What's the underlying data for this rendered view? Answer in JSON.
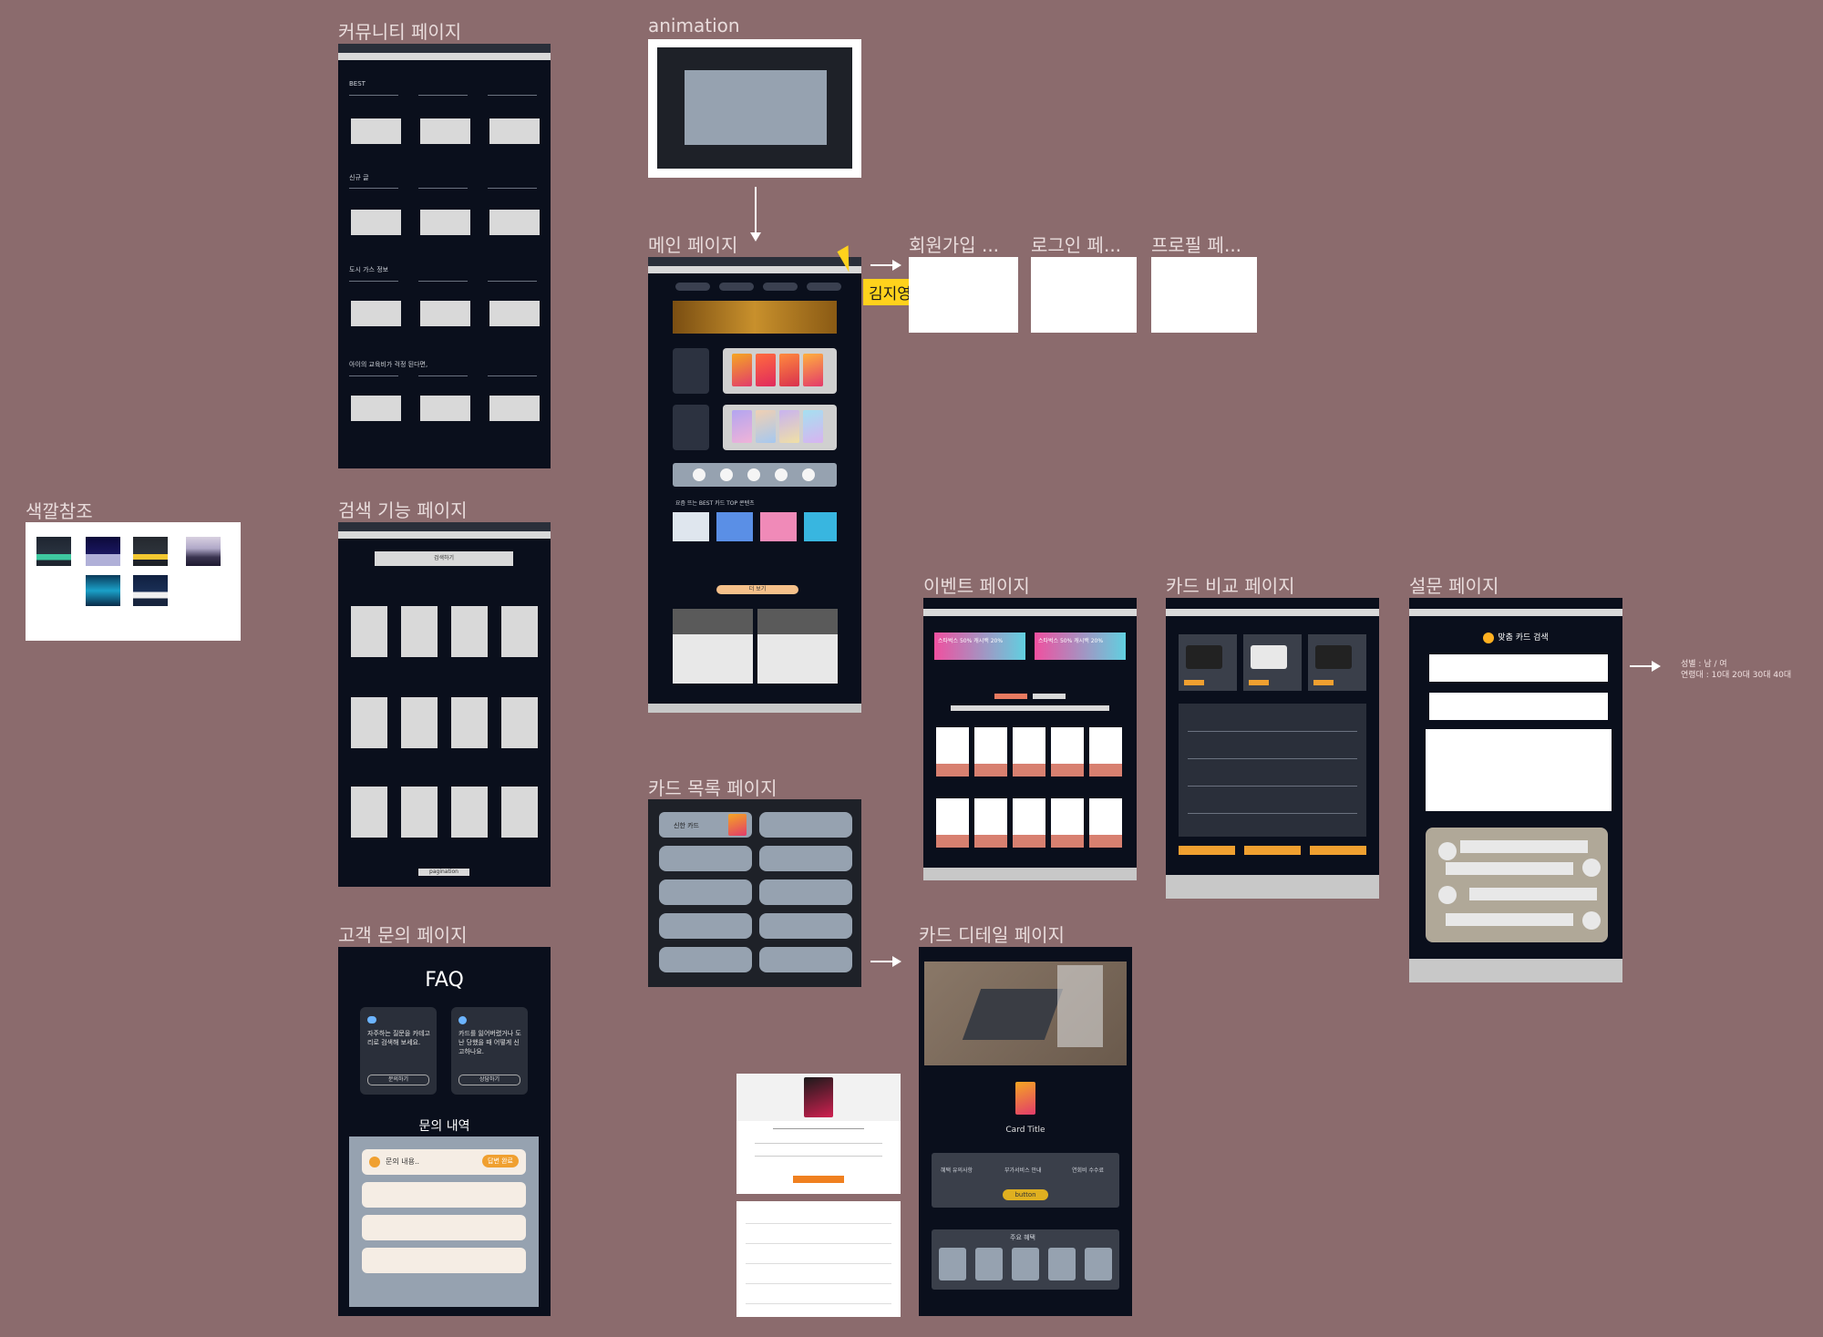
{
  "frames": {
    "community": {
      "title": "커뮤니티 페이지",
      "sections": [
        "BEST",
        "신규 글",
        "도시 가스 정보",
        "아이의 교육비가 걱정 된다면,"
      ]
    },
    "animation": {
      "title": "animation"
    },
    "main": {
      "title": "메인 페이지",
      "section_caption": "요즘 뜨는 BEST 카드 TOP 콘텐츠",
      "more_button": "더 보기"
    },
    "signup": {
      "title": "회원가입 ..."
    },
    "login": {
      "title": "로그인 페..."
    },
    "profile": {
      "title": "프로필 페..."
    },
    "cursor_badge": {
      "label": "김지영"
    },
    "color_ref": {
      "title": "색깔참조"
    },
    "search": {
      "title": "검색 기능 페이지",
      "search_label": "검색하기",
      "pagination": "pagination"
    },
    "event": {
      "title": "이벤트 페이지",
      "banner_1": "스타벅스 50% 캐시백 20%",
      "banner_2": "스타벅스 50% 캐시백 20%"
    },
    "compare": {
      "title": "카드 비교 페이지"
    },
    "survey": {
      "title": "설문 페이지",
      "heading": "맞춤 카드 검색",
      "side_note_1": "성별 : 남 / 여",
      "side_note_2": "연령대 : 10대 20대 30대 40대"
    },
    "support": {
      "title": "고객 문의 페이지",
      "faq": "FAQ",
      "faq_card_1": "자주하는 질문을 카테고리로 검색해 보세요.",
      "faq_card_2": "카드를 잃어버렸거나 도난 당했을 때 어떻게 신고하나요.",
      "faq_btn_1": "문의하기",
      "faq_btn_2": "상담하기",
      "history_title": "문의 내역",
      "history_item": "문의 내용..",
      "history_badge": "답변 완료"
    },
    "card_list": {
      "title": "카드 목록 페이지",
      "first_item": "신한 카드"
    },
    "card_detail": {
      "title": "카드 디테일 페이지",
      "card_title": "Card Title",
      "button": "button",
      "tabs": [
        "혜택 유의사항",
        "부가서비스 안내",
        "연회비 수수료"
      ],
      "recent": "주요 혜택"
    }
  },
  "colors": {
    "canvas": "#8b6b6d",
    "frame_dark": "#0a0f1c",
    "accent_orange": "#f0a030",
    "accent_yellow": "#ffd21c",
    "slate": "#96a2b0"
  },
  "icons": [
    "cursor-arrow-icon",
    "chevron-icon",
    "user-icon",
    "chat-icon"
  ]
}
